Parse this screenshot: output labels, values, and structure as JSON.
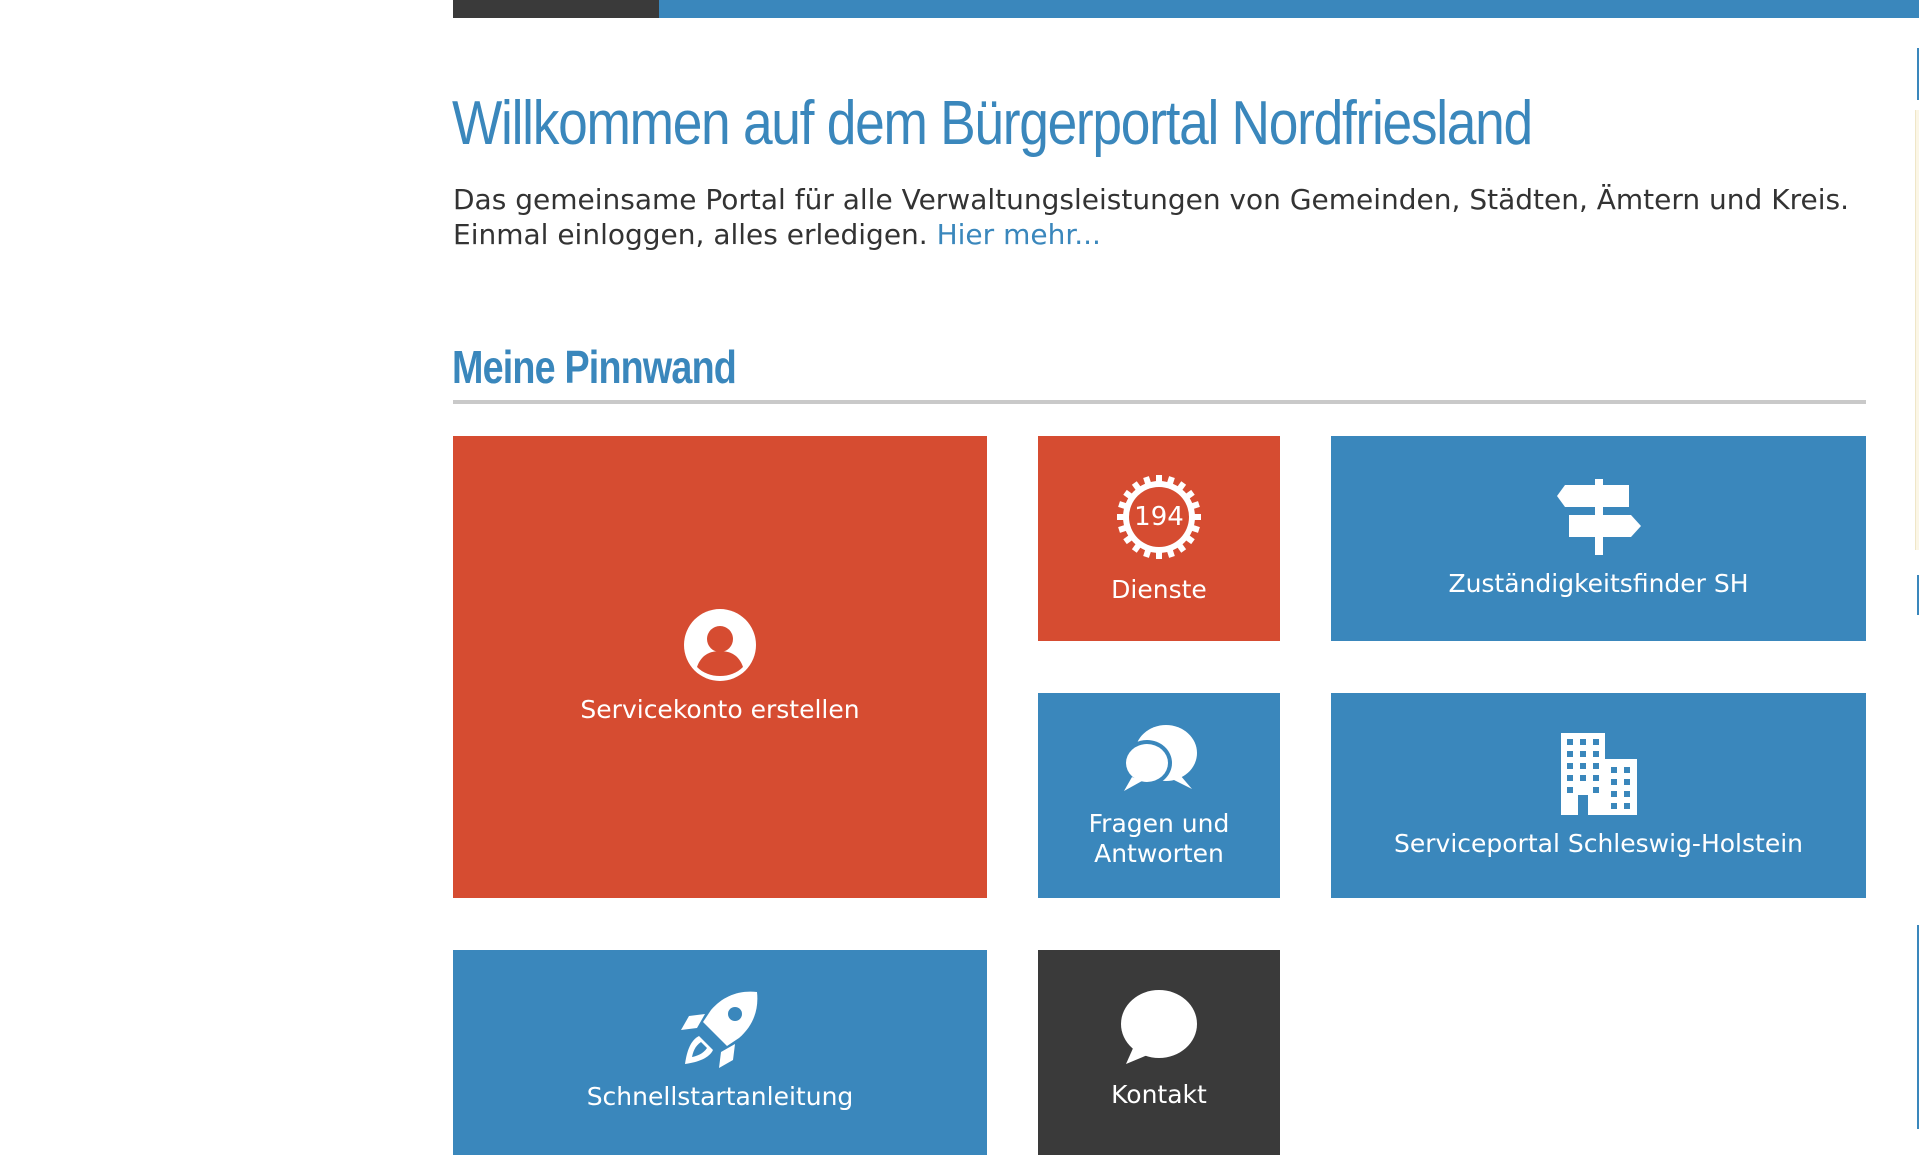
{
  "colors": {
    "brand_blue": "#3a87bc",
    "tile_red": "#d64c31",
    "tile_dark": "#3a3a3a",
    "text": "#333333",
    "rule": "#c9c9c9"
  },
  "welcome": {
    "title": "Willkommen auf dem Bürgerportal Nordfriesland",
    "intro_line1": "Das gemeinsame Portal für alle Verwaltungsleistungen von Gemeinden, Städten, Ämtern und Kreis.",
    "intro_line2": "Einmal einloggen, alles erledigen.",
    "more_link": "Hier mehr..."
  },
  "pinnwand": {
    "title": "Meine Pinnwand",
    "tiles": [
      {
        "label": "Servicekonto erstellen",
        "icon": "user-circle-icon",
        "color": "#d64c31"
      },
      {
        "label": "Dienste",
        "icon": "gear-icon",
        "count": "194",
        "color": "#d64c31"
      },
      {
        "label": "Zuständigkeitsfinder SH",
        "icon": "signpost-icon",
        "color": "#3a87bc"
      },
      {
        "label": "Fragen und Antworten",
        "icon": "chat-bubbles-icon",
        "color": "#3a87bc"
      },
      {
        "label": "Serviceportal Schleswig-Holstein",
        "icon": "building-icon",
        "color": "#3a87bc"
      },
      {
        "label": "Schnellstartanleitung",
        "icon": "rocket-icon",
        "color": "#3a87bc"
      },
      {
        "label": "Kontakt",
        "icon": "chat-bubble-icon",
        "color": "#3a3a3a"
      }
    ]
  }
}
